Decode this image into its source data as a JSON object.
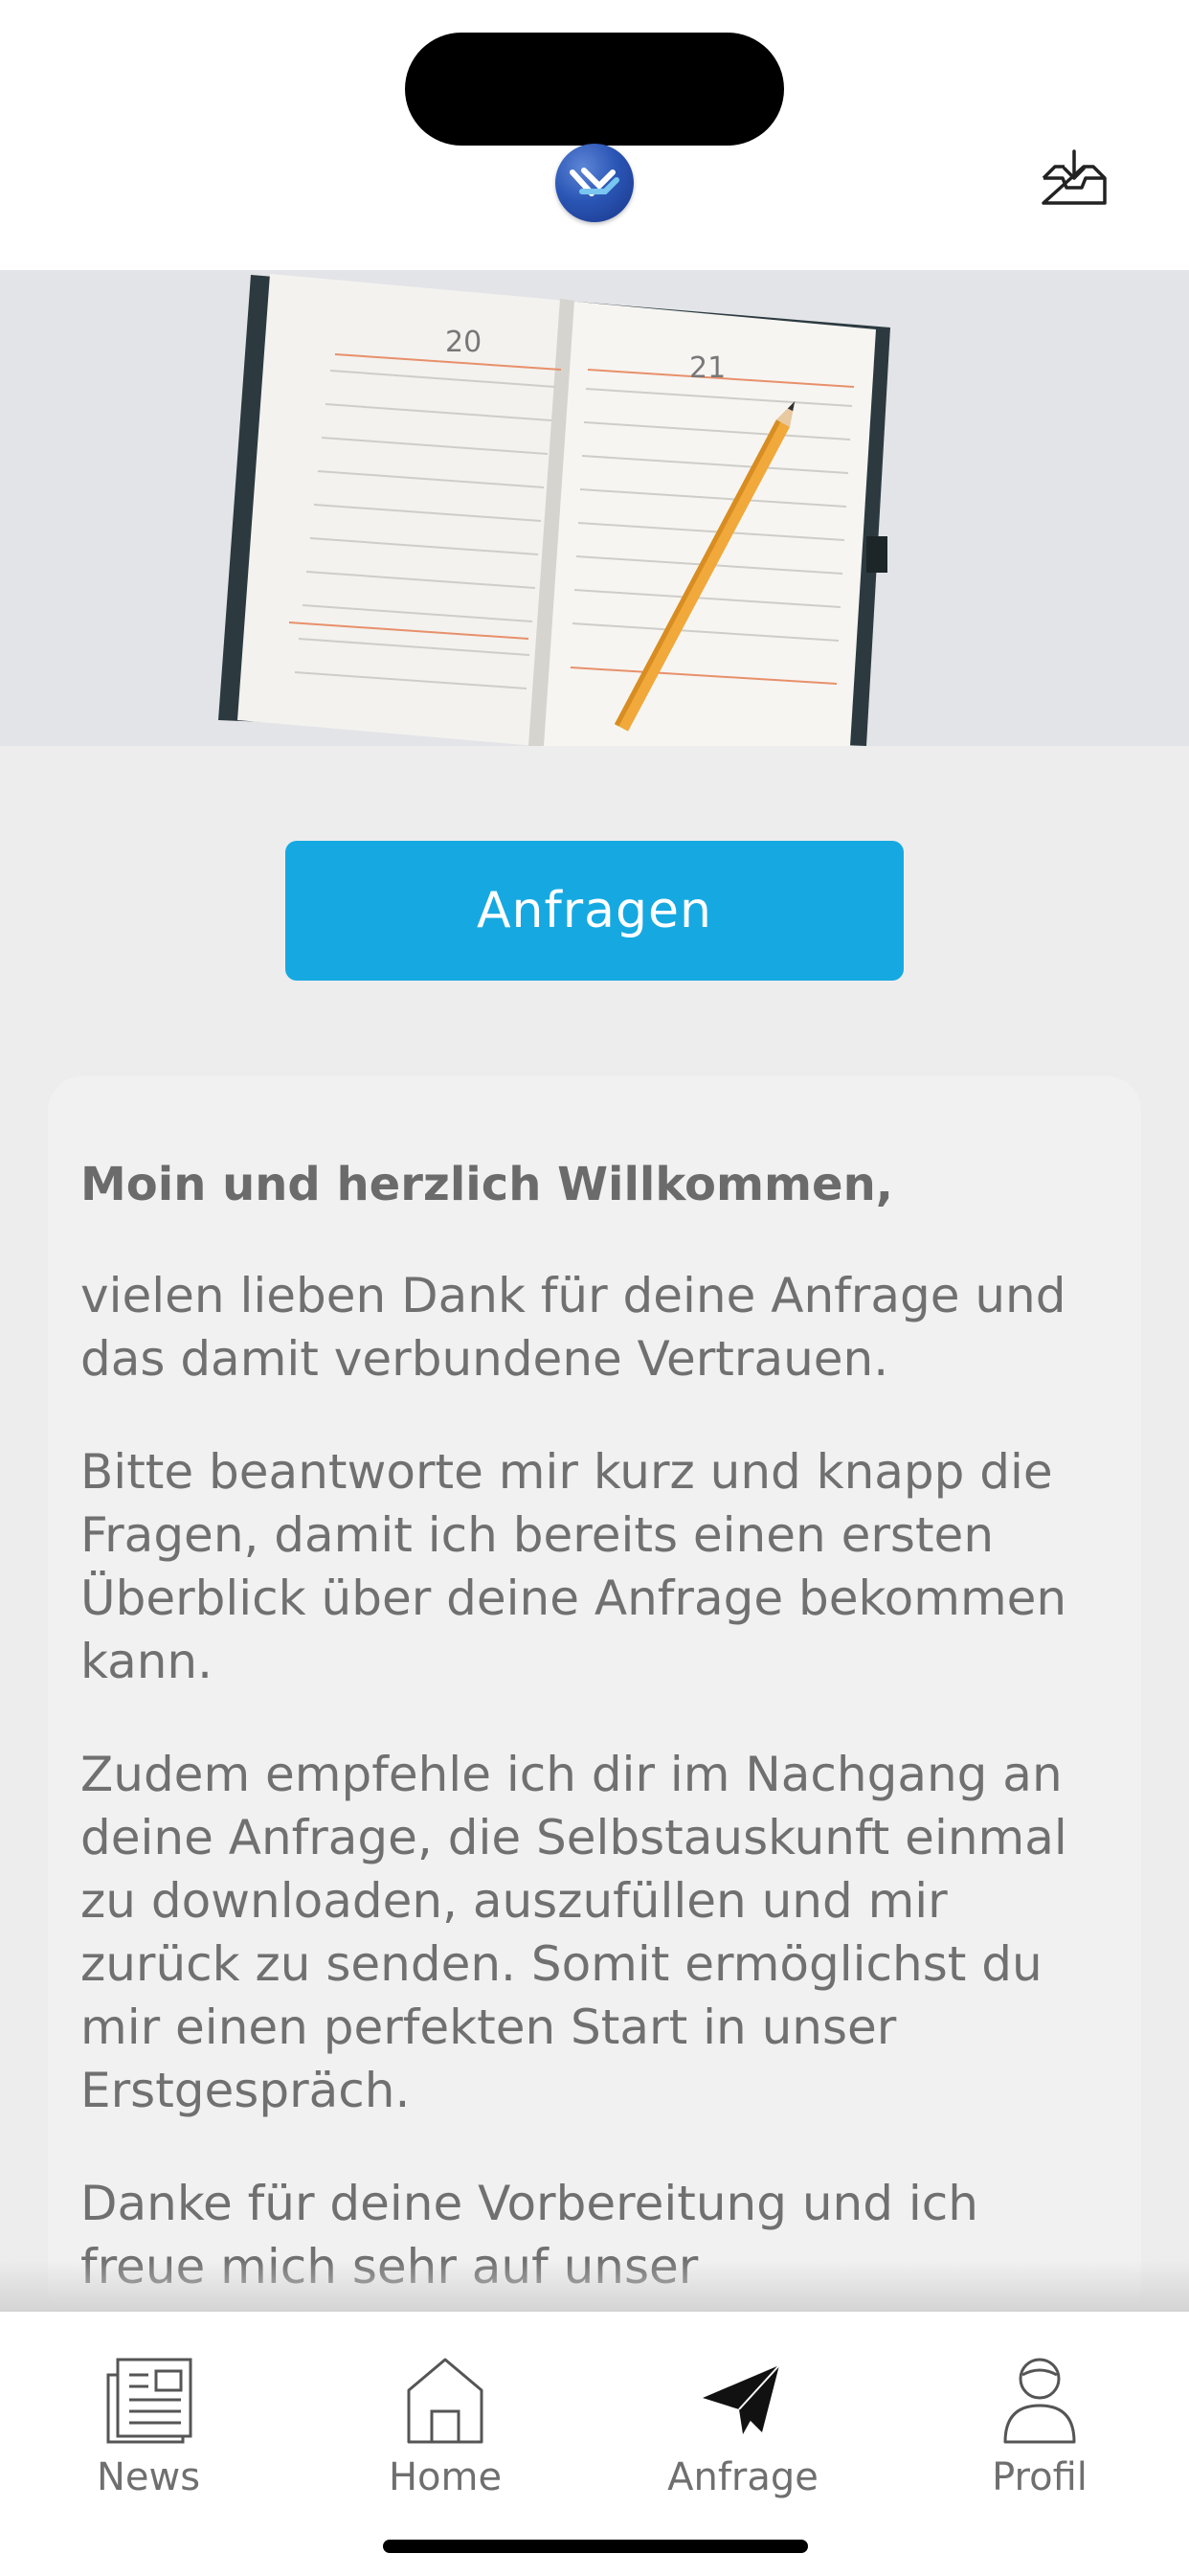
{
  "header": {
    "logo_icon": "brand-logo-icon",
    "inbox_icon": "inbox-download-icon"
  },
  "hero": {
    "image": "notebook-with-pencil-photo",
    "left_page_number": "20",
    "right_page_number": "21"
  },
  "cta": {
    "label": "Anfragen"
  },
  "card": {
    "greeting": "Moin und herzlich Willkommen,",
    "paragraphs": [
      "vielen lieben Dank für deine Anfrage und das damit verbundene Vertrauen.",
      "Bitte beantworte mir kurz und knapp die Fragen, damit ich bereits einen ersten Überblick über deine Anfrage bekommen kann.",
      "Zudem empfehle ich dir im Nachgang an deine Anfrage, die Selbstauskunft einmal zu downloaden, auszufüllen und mir zurück zu senden. Somit ermöglichst du mir einen perfekten Start in unser Erstgespräch.",
      "Danke für deine Vorbereitung und ich freue mich sehr auf unser"
    ]
  },
  "tabbar": {
    "tabs": [
      {
        "label": "News",
        "icon": "newspaper-icon",
        "active": false
      },
      {
        "label": "Home",
        "icon": "home-icon",
        "active": false
      },
      {
        "label": "Anfrage",
        "icon": "paper-plane-icon",
        "active": true
      },
      {
        "label": "Profil",
        "icon": "person-icon",
        "active": false
      }
    ]
  },
  "colors": {
    "accent": "#16a9e1",
    "background": "#ededed",
    "card": "#f1f1f1",
    "text": "#707070"
  }
}
